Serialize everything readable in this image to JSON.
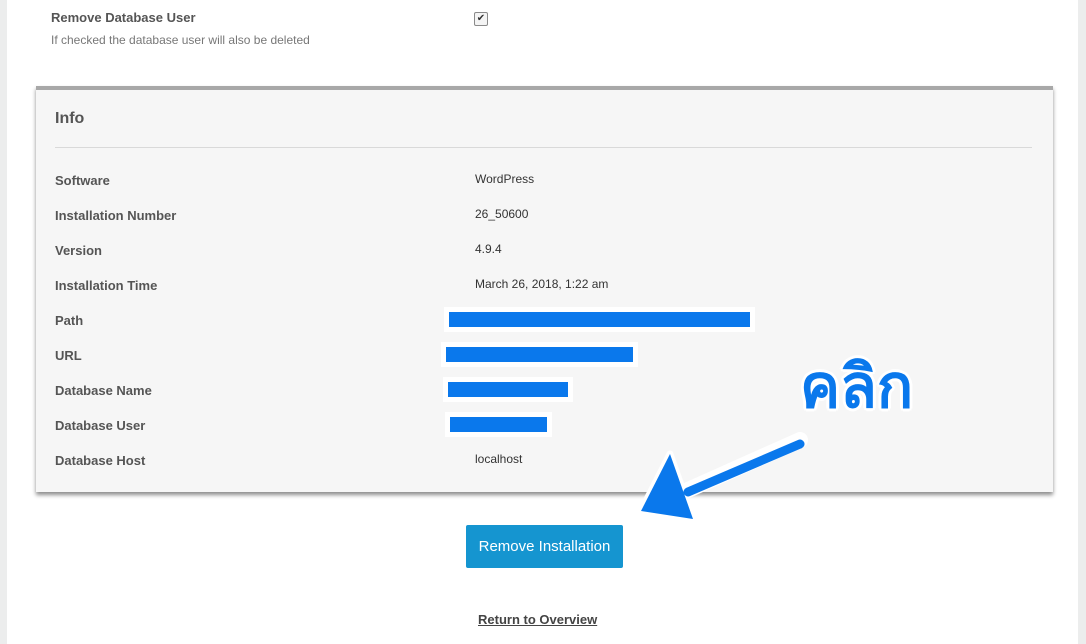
{
  "remove_db_user": {
    "title": "Remove Database User",
    "description": "If checked the database user will also be deleted",
    "checked": true,
    "check_glyph": "✔"
  },
  "info": {
    "title": "Info",
    "rows": [
      {
        "label": "Software",
        "value": "WordPress"
      },
      {
        "label": "Installation Number",
        "value": "26_50600"
      },
      {
        "label": "Version",
        "value": "4.9.4"
      },
      {
        "label": "Installation Time",
        "value": "March 26, 2018, 1:22 am"
      },
      {
        "label": "Path",
        "value": null,
        "redacted": true
      },
      {
        "label": "URL",
        "value": null,
        "redacted": true
      },
      {
        "label": "Database Name",
        "value": null,
        "redacted": true
      },
      {
        "label": "Database User",
        "value": null,
        "redacted": true
      },
      {
        "label": "Database Host",
        "value": "localhost"
      }
    ]
  },
  "actions": {
    "remove_label": "Remove Installation",
    "return_label": "Return to Overview"
  },
  "annotation": {
    "text": "คลิก",
    "color": "#0a78ec"
  },
  "colors": {
    "button": "#1595d0",
    "redaction": "#0a78ec",
    "panel_bg": "#f6f6f6"
  }
}
